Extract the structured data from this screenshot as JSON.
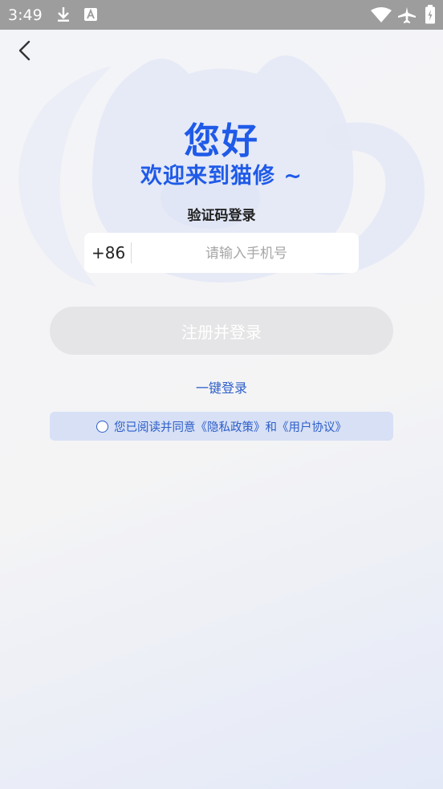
{
  "status_bar": {
    "time": "3:49",
    "left_icons": [
      "download-icon",
      "a-notification-icon"
    ],
    "right_icons": [
      "wifi-icon",
      "airplane-icon",
      "battery-icon"
    ]
  },
  "nav": {
    "back_icon": "chevron-left-icon"
  },
  "greeting": {
    "title": "您好",
    "subtitle": "欢迎来到猫修 ~"
  },
  "login_method": "验证码登录",
  "phone": {
    "country_code": "+86",
    "placeholder": "请输入手机号",
    "value": ""
  },
  "submit_label": "注册并登录",
  "quick_login_label": "一键登录",
  "agreement": {
    "text": "您已阅读并同意《隐私政策》和《用户协议》",
    "checked": false
  },
  "colors": {
    "accent": "#1f5ae8",
    "link": "#2d5ec9",
    "button_disabled": "#e5e5e7",
    "status_bar": "#9d9d9d"
  }
}
